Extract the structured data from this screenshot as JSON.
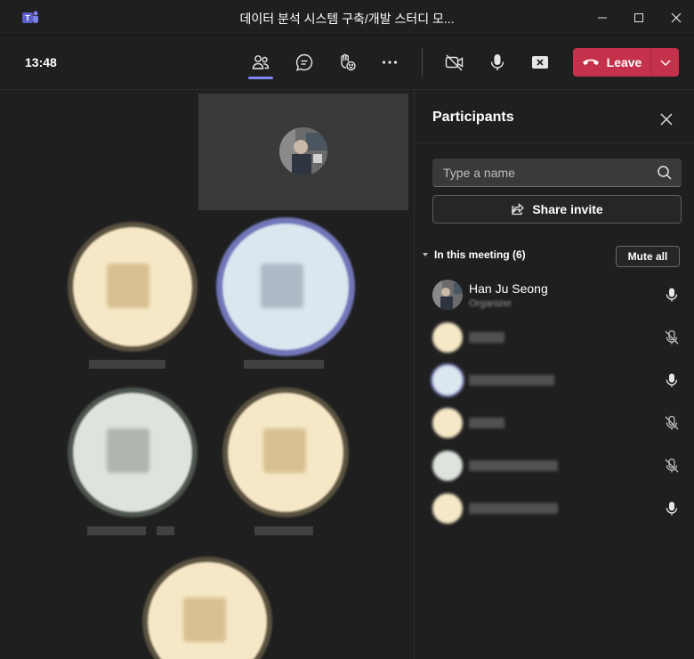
{
  "window": {
    "title": "데이터 분석 시스템 구축/개발 스터디 모...",
    "app_icon": "teams-logo-icon"
  },
  "toolbar": {
    "time": "13:48",
    "leave_label": "Leave",
    "icons": [
      "people-icon",
      "chat-icon",
      "raise-hand-icon",
      "more-icon",
      "camera-off-icon",
      "mic-icon",
      "share-tray-icon"
    ]
  },
  "panel": {
    "title": "Participants",
    "search_placeholder": "Type a name",
    "share_invite_label": "Share invite",
    "section_label": "In this meeting (6)",
    "mute_all_label": "Mute all",
    "participants": [
      {
        "name": "Han Ju Seong",
        "role": "Organizer",
        "mic": "on"
      },
      {
        "name": "",
        "role": "",
        "mic": "muted"
      },
      {
        "name": "",
        "role": "",
        "mic": "on"
      },
      {
        "name": "",
        "role": "",
        "mic": "muted"
      },
      {
        "name": "",
        "role": "",
        "mic": "muted"
      },
      {
        "name": "",
        "role": "",
        "mic": "on"
      }
    ]
  },
  "colors": {
    "accent": "#7f85f5",
    "leave": "#c4314b",
    "background": "#1f1f1f"
  }
}
